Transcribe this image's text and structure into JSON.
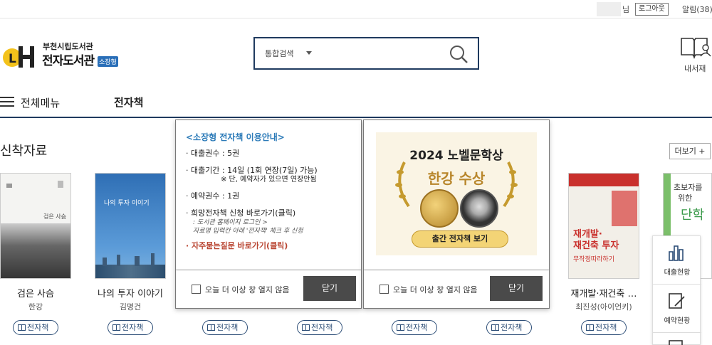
{
  "topbar": {
    "user_suffix": "님",
    "logout": "로그아웃",
    "alarm": "알림(38)"
  },
  "header": {
    "library_name": "부천시립도서관",
    "service_name": "전자도서관",
    "service_tag": "소장형",
    "search_scope": "통합검색",
    "mylib_label": "내서재"
  },
  "nav": {
    "all_menu": "전체메뉴",
    "ebook": "전자책"
  },
  "section": {
    "title": "신착자료",
    "more": "더보기 +"
  },
  "books": [
    {
      "title": "검은 사슴",
      "author": "한강",
      "format": "전자책"
    },
    {
      "title": "나의 투자 이야기",
      "author": "김명건",
      "format": "전자책"
    },
    {
      "title": "",
      "author": "",
      "format": "전자책"
    },
    {
      "title": "",
      "author": "",
      "format": "전자책"
    },
    {
      "title": "",
      "author": "",
      "format": "전자책"
    },
    {
      "title": "",
      "author": "",
      "format": "전자책"
    },
    {
      "title": "재개발·재건축 …",
      "author": "최진성(아이언키)",
      "format": "전자책"
    },
    {
      "title": "",
      "author": "",
      "format": ""
    }
  ],
  "covers": {
    "b1_small": "검은 사슴",
    "b2_title": "나의 투자 이야기",
    "b7_title_1": "재개발·",
    "b7_title_2": "재건축 투자",
    "b7_sub": "무작정따라하기",
    "b8_title_1": "초보자를",
    "b8_title_2": "위한",
    "b8_title_3": "단학"
  },
  "popup1": {
    "title": "<소장형 전자책 이용안내>",
    "loan_count": "· 대출권수 : 5권",
    "loan_period": "· 대출기간 : 14일 (1회 연장(7일) 가능)",
    "loan_period_note": "※ 단, 예약자가 있으면 연장안됨",
    "reserve_count": "· 예약권수 : 1권",
    "wish_link": "· 희망전자책 신청 바로가기(클릭)",
    "wish_note_1": ": 도서관 홈페이지 로그인 >",
    "wish_note_2": "자료명 입력칸 아래 '전자책' 체크 후 신청",
    "faq_link": "· 자주묻는질문 바로가기(클릭)",
    "dont_show": "오늘 더 이상 창 열지 않음",
    "close": "닫기"
  },
  "popup2": {
    "banner_title": "2024 노벨문학상",
    "banner_name": "한강 수상",
    "banner_button": "출간 전자책 보기",
    "dont_show": "오늘 더 이상 창 열지 않음",
    "close": "닫기"
  },
  "quickmenu": {
    "loan_status": "대출현황",
    "reserve_status": "예약현황"
  },
  "colors": {
    "navy": "#1f3a5f",
    "link_blue": "#2b7ab8",
    "faq_red": "#b8432f",
    "close_btn": "#4a4a4a"
  }
}
